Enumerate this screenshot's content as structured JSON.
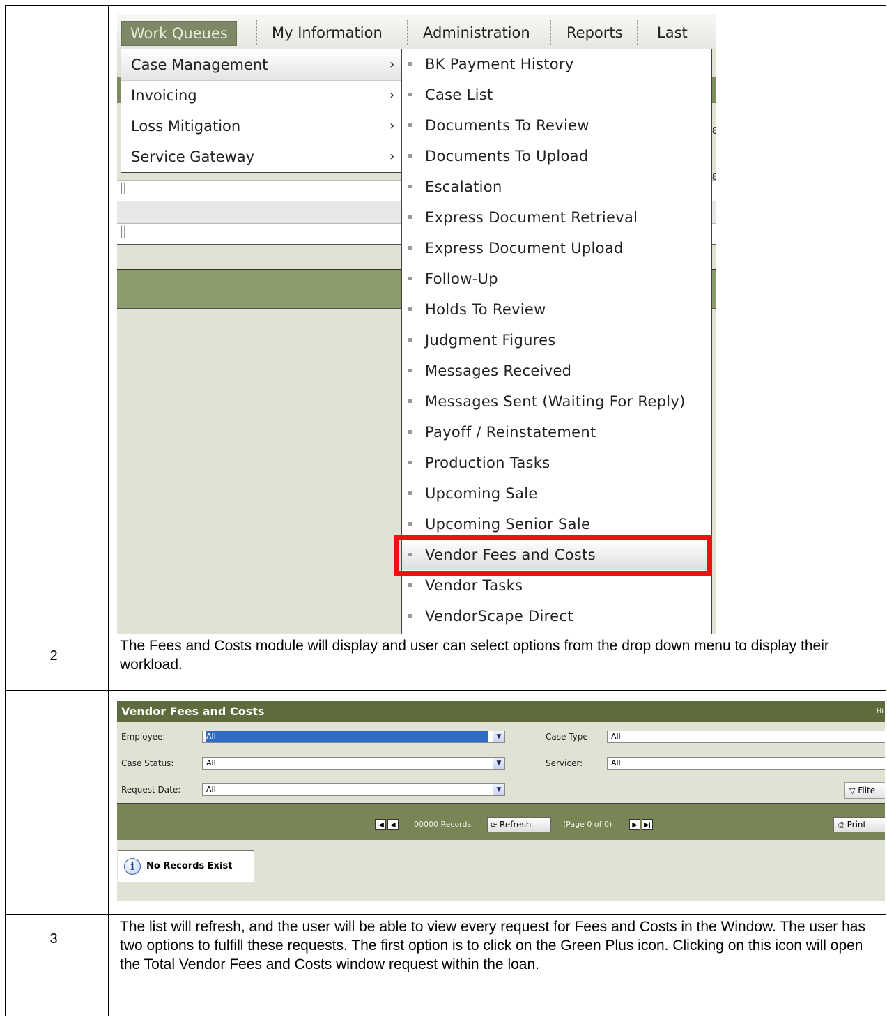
{
  "menu": {
    "top_items": [
      "Work Queues",
      "My Information",
      "Administration",
      "Reports",
      "Last Vie"
    ],
    "submenu1": [
      "Case Management",
      "Invoicing",
      "Loss Mitigation",
      "Service Gateway"
    ],
    "submenu1_chevron": "›",
    "submenu2": [
      "BK Payment History",
      "Case List",
      "Documents To Review",
      "Documents To Upload",
      "Escalation",
      "Express Document Retrieval",
      "Express Document Upload",
      "Follow-Up",
      "Holds To Review",
      "Judgment Figures",
      "Messages Received",
      "Messages Sent (Waiting For Reply)",
      "Payoff / Reinstatement",
      "Production Tasks",
      "Upcoming Sale",
      "Upcoming Senior Sale",
      "Vendor Fees and Costs",
      "Vendor Tasks",
      "VendorScape Direct"
    ],
    "highlighted_item": "Vendor Fees and Costs",
    "bg_glyphs": [
      "ε",
      "ε"
    ]
  },
  "steps": [
    {
      "number": "2",
      "text": "The Fees and Costs module will display and user can select options from the drop down menu to display their workload."
    },
    {
      "number": "3",
      "text": "The list will refresh, and the user will be able to view every request for Fees and Costs in the Window.  The user has two options to fulfill these requests.  The first option is to click on the Green Plus icon.  Clicking on this icon will open the Total Vendor Fees and Costs window request within the loan."
    }
  ],
  "vendor_module": {
    "title": "Vendor Fees and Costs",
    "header_right": "Hi",
    "filters": {
      "employee": {
        "label": "Employee:",
        "value": "All"
      },
      "case_status": {
        "label": "Case Status:",
        "value": "All"
      },
      "request_date": {
        "label": "Request Date:",
        "value": "All"
      },
      "case_type": {
        "label": "Case Type",
        "value": "All"
      },
      "servicer": {
        "label": "Servicer:",
        "value": "All"
      }
    },
    "filter_button": "Filte",
    "pager": {
      "records": "00000 Records",
      "refresh": "Refresh",
      "page_info": "(Page 0 of 0)",
      "print": "Print"
    },
    "no_records": "No Records Exist"
  },
  "colors": {
    "highlight_box": "#ee1111",
    "module_header": "#5e6b3c",
    "menu_active": "#7e8866"
  }
}
